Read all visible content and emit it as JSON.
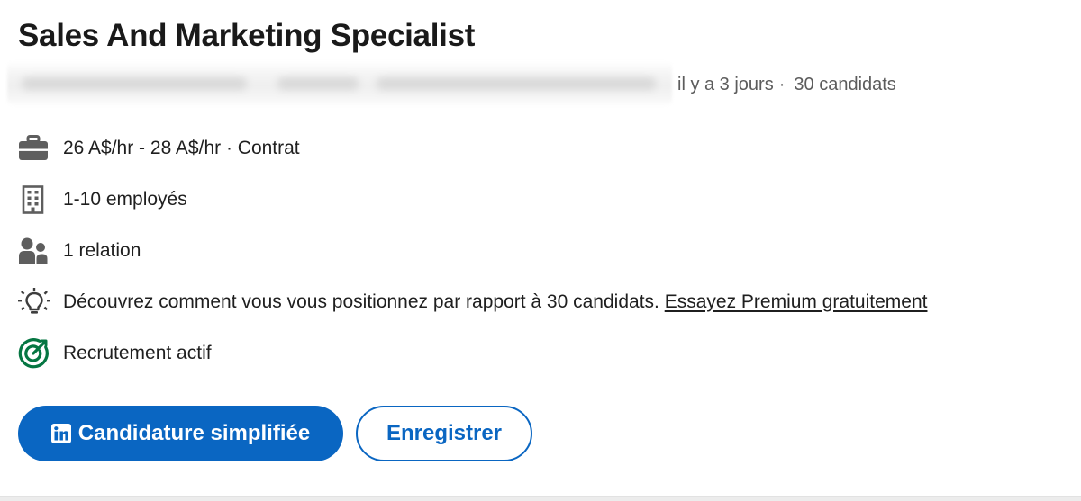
{
  "job": {
    "title": "Sales And Marketing Specialist",
    "posted": "il y a 3 jours",
    "separator": "·",
    "applicants": "30 candidats"
  },
  "details": {
    "salary": "26 A$/hr - 28 A$/hr · Contrat",
    "company_size": "1-10 employés",
    "connections": "1 relation",
    "premium_prompt": "Découvrez comment vous vous positionnez par rapport à 30 candidats.",
    "premium_link": "Essayez Premium gratuitement",
    "hiring_status": "Recrutement actif"
  },
  "icons": {
    "salary": "briefcase-icon",
    "company_size": "building-icon",
    "connections": "people-icon",
    "premium": "lightbulb-icon",
    "hiring": "target-icon",
    "apply": "linkedin-logo-icon"
  },
  "actions": {
    "easy_apply": "Candidature simplifiée",
    "save": "Enregistrer"
  },
  "colors": {
    "brand_blue": "#0a66c2",
    "hiring_green": "#057642",
    "icon_gray": "#5e5e5e",
    "meta_gray": "#5c5c5c"
  }
}
